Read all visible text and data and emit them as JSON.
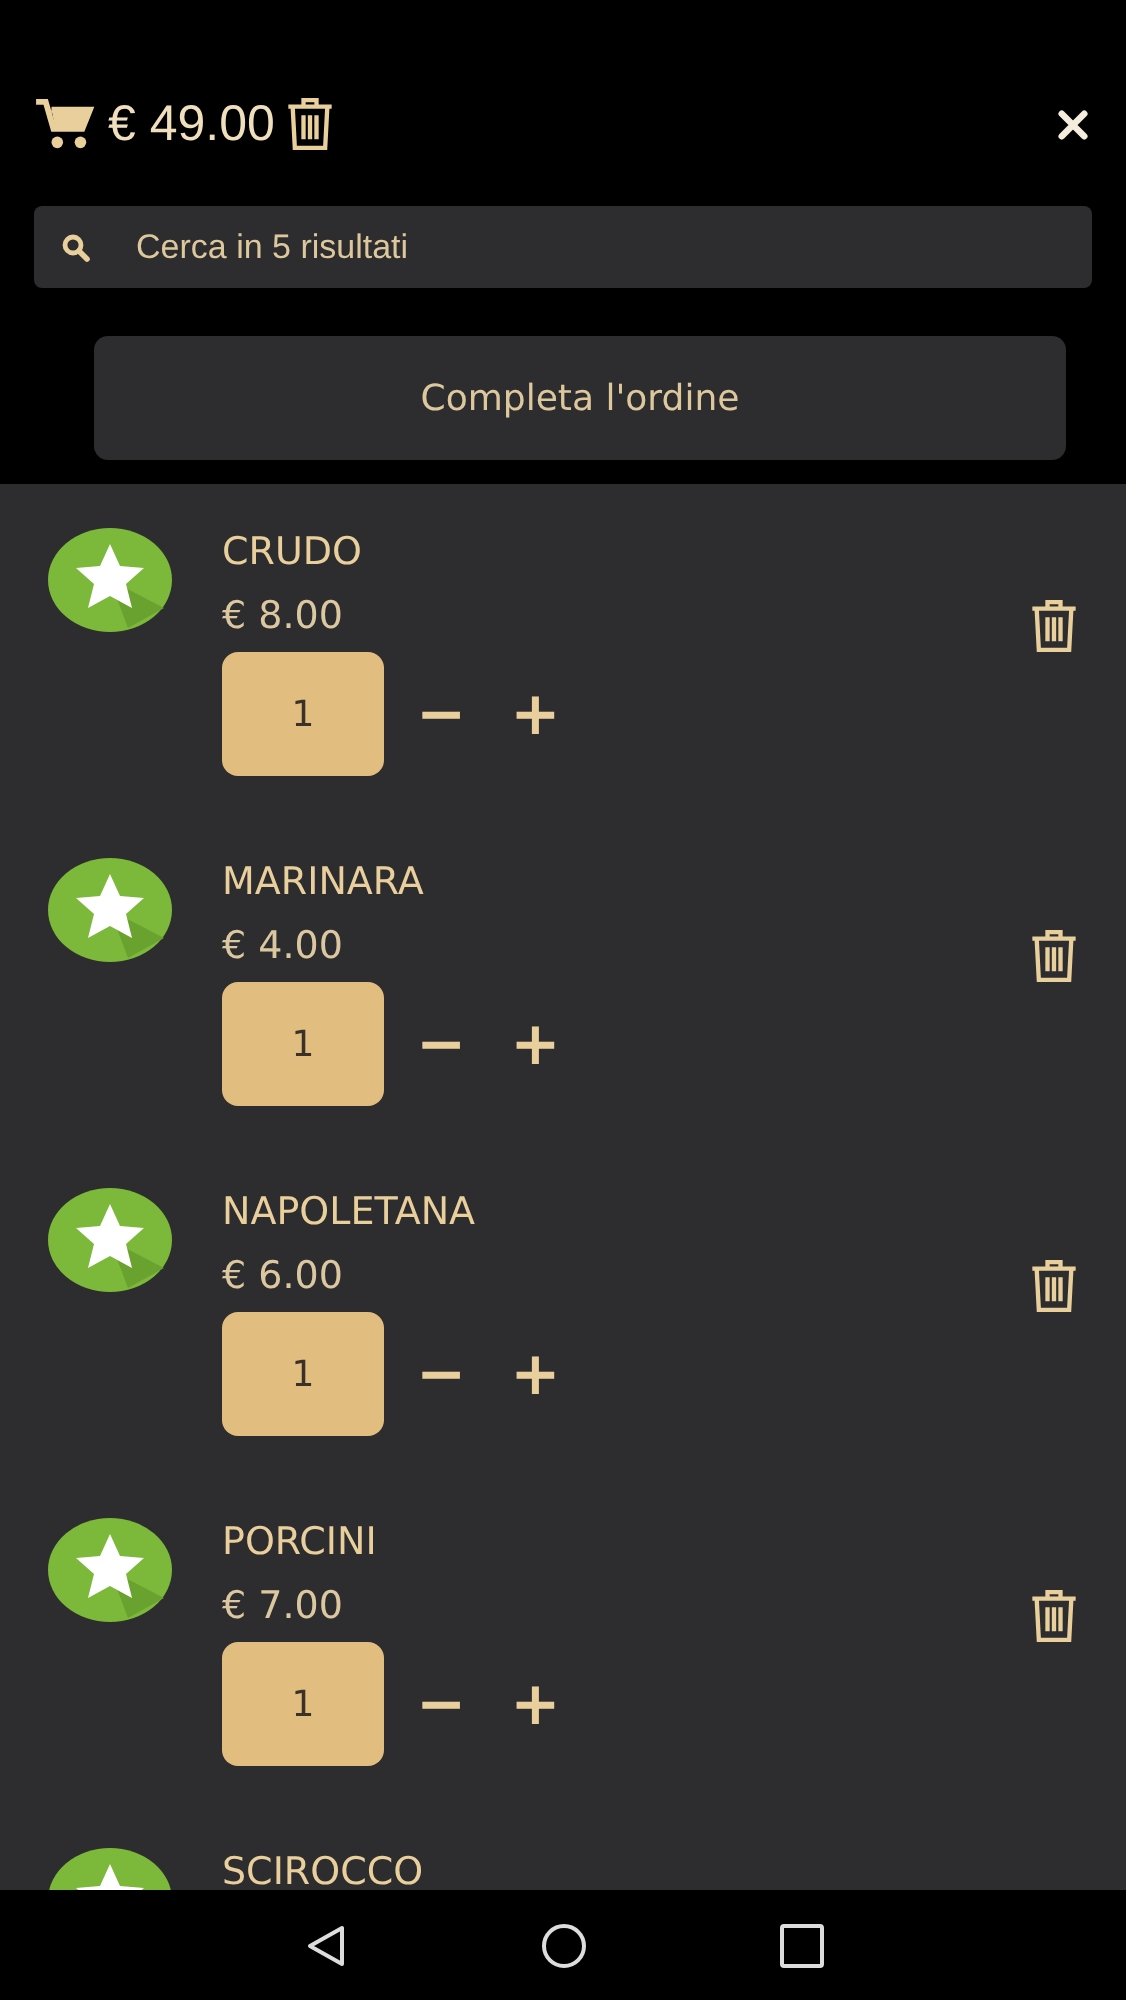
{
  "header": {
    "total": "€ 49.00"
  },
  "search": {
    "placeholder": "Cerca in 5 risultati"
  },
  "checkout_button": "Completa l'ordine",
  "items": [
    {
      "name": "CRUDO",
      "price": "€ 8.00",
      "quantity": "1",
      "decrement": "−",
      "increment": "+"
    },
    {
      "name": "MARINARA",
      "price": "€ 4.00",
      "quantity": "1",
      "decrement": "−",
      "increment": "+"
    },
    {
      "name": "NAPOLETANA",
      "price": "€ 6.00",
      "quantity": "1",
      "decrement": "−",
      "increment": "+"
    },
    {
      "name": "PORCINI",
      "price": "€ 7.00",
      "quantity": "1",
      "decrement": "−",
      "increment": "+"
    },
    {
      "name": "SCIROCCO"
    }
  ]
}
